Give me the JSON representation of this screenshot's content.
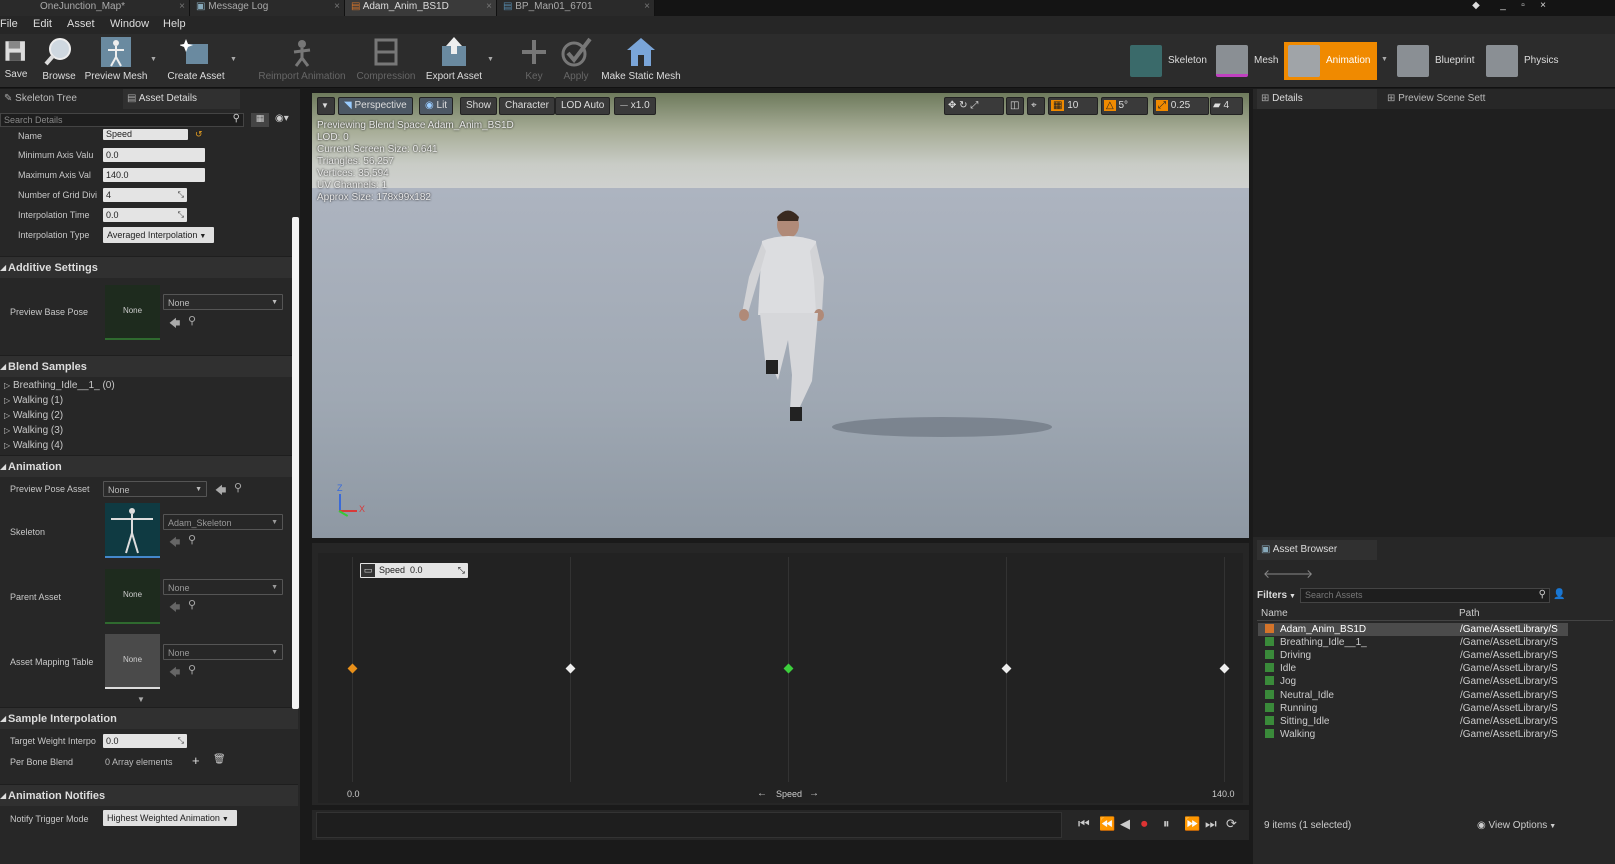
{
  "doc_tabs": [
    {
      "label": "OneJunction_Map*"
    },
    {
      "label": "Message Log"
    },
    {
      "label": "Adam_Anim_BS1D"
    },
    {
      "label": "BP_Man01_6701"
    }
  ],
  "menu": [
    "File",
    "Edit",
    "Asset",
    "Window",
    "Help"
  ],
  "toolbar": {
    "save": "Save",
    "browse": "Browse",
    "preview_mesh": "Preview Mesh",
    "create_asset": "Create Asset",
    "reimport": "Reimport Animation",
    "compression": "Compression",
    "export": "Export Asset",
    "key": "Key",
    "apply": "Apply",
    "make_static_mesh": "Make Static Mesh"
  },
  "modes": {
    "skeleton": "Skeleton",
    "mesh": "Mesh",
    "animation": "Animation",
    "blueprint": "Blueprint",
    "physics": "Physics"
  },
  "left_tabs": {
    "skeleton_tree": "Skeleton Tree",
    "asset_details": "Asset Details"
  },
  "search_details": "Search Details",
  "axis": {
    "name_label": "Name",
    "name_value": "Speed",
    "min_label": "Minimum Axis Valu",
    "min_value": "0.0",
    "max_label": "Maximum Axis Val",
    "max_value": "140.0",
    "grid_label": "Number of Grid Divi",
    "grid_value": "4",
    "interp_time_label": "Interpolation Time",
    "interp_time_value": "0.0",
    "interp_type_label": "Interpolation Type",
    "interp_type_value": "Averaged Interpolation"
  },
  "additive": {
    "title": "Additive Settings",
    "preview_base_pose_label": "Preview Base Pose",
    "thumb": "None",
    "dropdown": "None"
  },
  "blend_samples": {
    "title": "Blend Samples",
    "items": [
      "Breathing_Idle__1_ (0)",
      "Walking (1)",
      "Walking (2)",
      "Walking (3)",
      "Walking (4)"
    ]
  },
  "animation_section": {
    "title": "Animation",
    "preview_pose_label": "Preview Pose Asset",
    "preview_pose_value": "None",
    "skeleton_label": "Skeleton",
    "skeleton_value": "Adam_Skeleton",
    "parent_label": "Parent Asset",
    "parent_thumb": "None",
    "parent_value": "None",
    "mapping_label": "Asset Mapping Table",
    "mapping_thumb": "None",
    "mapping_value": "None"
  },
  "sample_interp": {
    "title": "Sample Interpolation",
    "target_label": "Target Weight Interpo",
    "target_value": "0.0",
    "per_bone_label": "Per Bone Blend",
    "per_bone_value": "0 Array elements"
  },
  "notifies": {
    "title": "Animation Notifies",
    "trigger_label": "Notify Trigger Mode",
    "trigger_value": "Highest Weighted Animation"
  },
  "viewport": {
    "perspective": "Perspective",
    "lit": "Lit",
    "show": "Show",
    "character": "Character",
    "lod": "LOD Auto",
    "speed": "x1.0",
    "grid": "10",
    "angle": "5°",
    "scale": "0.25",
    "camera_speed": "4",
    "stats": [
      "Previewing Blend Space Adam_Anim_BS1D",
      "LOD: 0",
      "Current Screen Size: 0.641",
      "Triangles: 56,257",
      "Vertices: 35,594",
      "UV Channels: 1",
      "Approx Size: 178x99x182"
    ],
    "axis_z": "Z",
    "axis_x": "X"
  },
  "blend_space": {
    "param_label": "Speed",
    "param_value": "0.0",
    "x_min": "0.0",
    "x_max": "140.0",
    "x_axis_label": "Speed",
    "arrow_left": "←",
    "arrow_right": "→",
    "samples": [
      {
        "speed": 0,
        "kind": "current"
      },
      {
        "speed": 35,
        "kind": "sample"
      },
      {
        "speed": 70,
        "kind": "highlight"
      },
      {
        "speed": 105,
        "kind": "sample"
      },
      {
        "speed": 140,
        "kind": "sample"
      }
    ]
  },
  "right_tabs": {
    "details": "Details",
    "preview_scene": "Preview Scene Sett"
  },
  "asset_browser": {
    "title": "Asset Browser",
    "filters": "Filters",
    "search_placeholder": "Search Assets",
    "col_name": "Name",
    "col_path": "Path",
    "rows": [
      {
        "name": "Adam_Anim_BS1D",
        "path": "/Game/AssetLibrary/S"
      },
      {
        "name": "Breathing_Idle__1_",
        "path": "/Game/AssetLibrary/S"
      },
      {
        "name": "Driving",
        "path": "/Game/AssetLibrary/S"
      },
      {
        "name": "Idle",
        "path": "/Game/AssetLibrary/S"
      },
      {
        "name": "Jog",
        "path": "/Game/AssetLibrary/S"
      },
      {
        "name": "Neutral_Idle",
        "path": "/Game/AssetLibrary/S"
      },
      {
        "name": "Running",
        "path": "/Game/AssetLibrary/S"
      },
      {
        "name": "Sitting_Idle",
        "path": "/Game/AssetLibrary/S"
      },
      {
        "name": "Walking",
        "path": "/Game/AssetLibrary/S"
      }
    ],
    "status": "9 items (1 selected)",
    "view_options": "View Options"
  },
  "colors": {
    "accent": "#f08a00",
    "current_sample": "#e8901a",
    "highlight_sample": "#3ccf3c"
  }
}
